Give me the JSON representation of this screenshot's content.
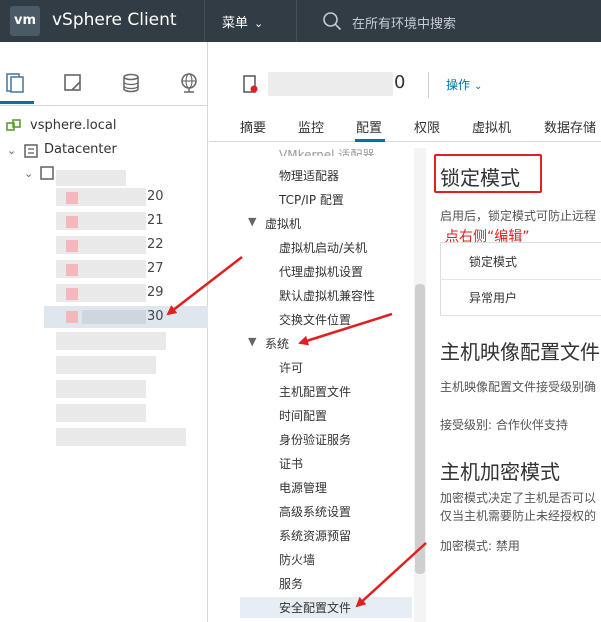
{
  "header": {
    "logo": "vm",
    "brand": "vSphere Client",
    "menu_label": "菜单",
    "search_placeholder": "在所有环境中搜索"
  },
  "tree": {
    "root": "vsphere.local",
    "datacenter": "Datacenter",
    "host_suffixes": [
      "20",
      "21",
      "22",
      "27",
      "29",
      "30"
    ]
  },
  "host": {
    "name_suffix": "0",
    "actions_label": "操作"
  },
  "tabs": [
    "摘要",
    "监控",
    "配置",
    "权限",
    "虚拟机",
    "数据存储"
  ],
  "nav": {
    "truncated_top": "VMkernel 适配器",
    "items_top": [
      "物理适配器",
      "TCP/IP 配置"
    ],
    "group_vm": "虚拟机",
    "vm_items": [
      "虚拟机启动/关机",
      "代理虚拟机设置",
      "默认虚拟机兼容性",
      "交换文件位置"
    ],
    "group_system": "系统",
    "system_items": [
      "许可",
      "主机配置文件",
      "时间配置",
      "身份验证服务",
      "证书",
      "电源管理",
      "高级系统设置",
      "系统资源预留",
      "防火墙",
      "服务",
      "安全配置文件"
    ]
  },
  "content": {
    "lock_title": "锁定模式",
    "lock_desc": "启用后，锁定模式可防止远程",
    "hint": "点右侧“编辑”",
    "prop_lock": "锁定模式",
    "prop_users": "异常用户",
    "image_title": "主机映像配置文件",
    "image_desc": "主机映像配置文件接受级别确",
    "accept_level": "接受级别: 合作伙伴支持",
    "encrypt_title": "主机加密模式",
    "encrypt_desc1": "加密模式决定了主机是否可以",
    "encrypt_desc2": "仅当主机需要防止未经授权的",
    "encrypt_mode": "加密模式: 禁用"
  },
  "colors": {
    "header_bg": "#313c45",
    "accent": "#0072a3",
    "annotation_red": "#e02020"
  }
}
